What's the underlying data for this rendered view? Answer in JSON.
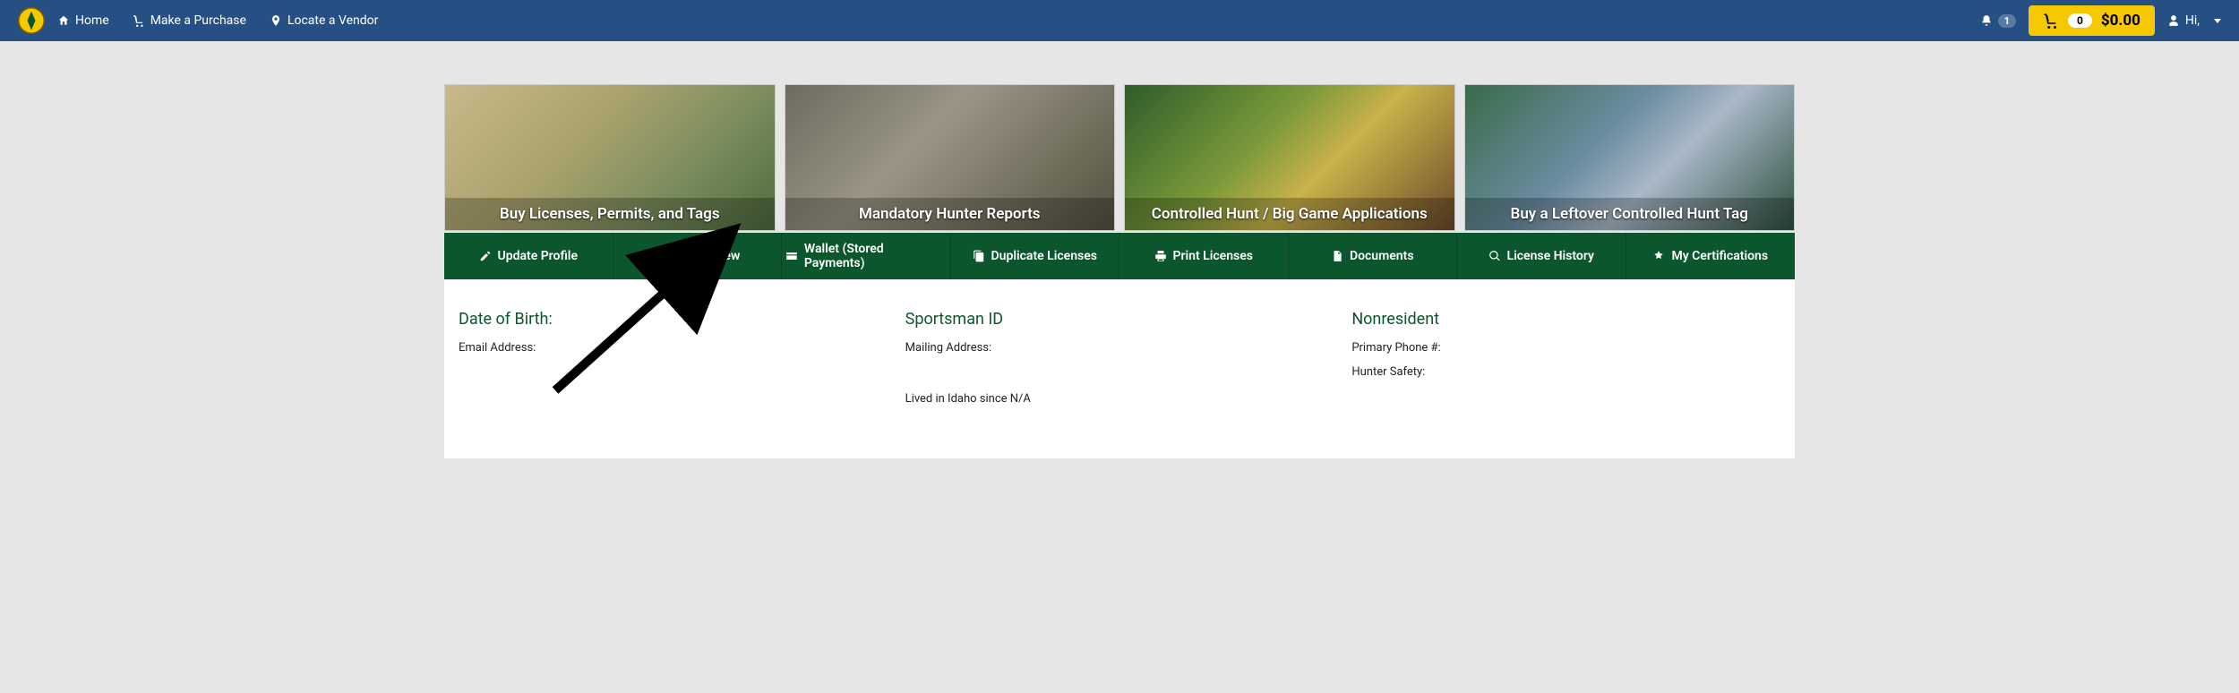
{
  "header": {
    "nav": {
      "home": "Home",
      "purchase": "Make a Purchase",
      "vendor": "Locate a Vendor"
    },
    "notifications_count": "1",
    "cart_count": "0",
    "cart_total": "$0.00",
    "greeting": "Hi,"
  },
  "tiles": [
    {
      "caption": "Buy Licenses, Permits, and Tags"
    },
    {
      "caption": "Mandatory Hunter Reports"
    },
    {
      "caption": "Controlled Hunt / Big Game Applications"
    },
    {
      "caption": "Buy a Leftover Controlled Hunt Tag"
    }
  ],
  "greenbar": [
    "Update Profile",
    "Auto Renew",
    "Wallet (Stored Payments)",
    "Duplicate Licenses",
    "Print Licenses",
    "Documents",
    "License History",
    "My Certifications"
  ],
  "profile": {
    "dob_label": "Date of Birth:",
    "email_label": "Email Address:",
    "sportsman_label": "Sportsman ID",
    "mailing_label": "Mailing Address:",
    "lived_text": "Lived in Idaho since N/A",
    "residency_label": "Nonresident",
    "phone_label": "Primary Phone #:",
    "safety_label": "Hunter Safety:"
  }
}
